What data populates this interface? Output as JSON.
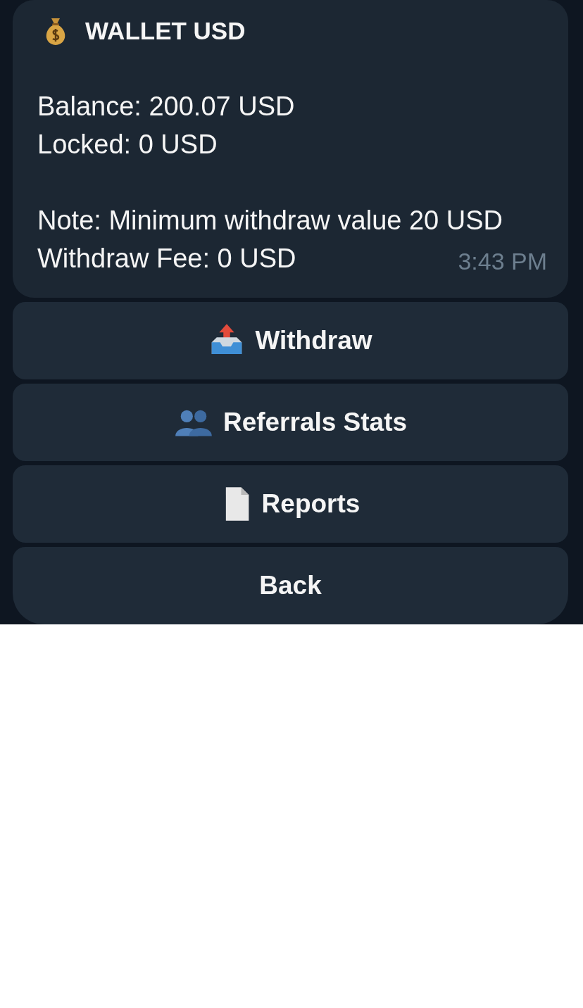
{
  "message": {
    "title": "WALLET USD",
    "paragraphs": [
      [
        "Balance: 200.07 USD",
        "Locked: 0 USD"
      ],
      [
        "Note: Minimum withdraw value 20 USD",
        "Withdraw Fee: 0 USD"
      ]
    ],
    "time": "3:43 PM"
  },
  "buttons": [
    {
      "label": "Withdraw",
      "kind": "outbox"
    },
    {
      "label": "Referrals Stats",
      "kind": "people"
    },
    {
      "label": "Reports",
      "kind": "document"
    },
    {
      "label": "Back",
      "kind": "plain"
    }
  ]
}
